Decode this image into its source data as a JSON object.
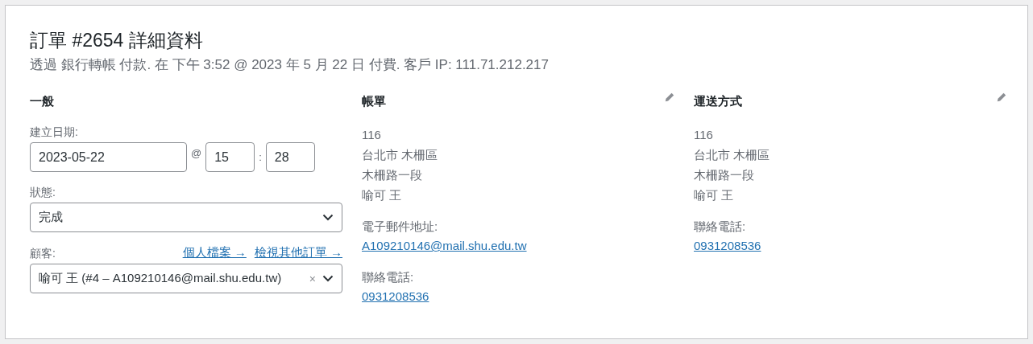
{
  "title": "訂單 #2654 詳細資料",
  "subtitle": "透過 銀行轉帳 付款. 在 下午 3:52 @ 2023 年 5 月 22 日 付費. 客戶 IP: 111.71.212.217",
  "general": {
    "heading": "一般",
    "date_label": "建立日期:",
    "date": "2023-05-22",
    "at": "@",
    "hour": "15",
    "colon": ":",
    "minute": "28",
    "status_label": "狀態:",
    "status": "完成",
    "customer_label": "顧客:",
    "links": [
      "個人檔案 →",
      "檢視其他訂單 →"
    ],
    "customer": "喻可 王 (#4 – A109210146@mail.shu.edu.tw)",
    "clear": "×"
  },
  "columns": [
    {
      "heading": "帳單",
      "address_lines": [
        "116",
        "台北市 木柵區",
        "木柵路一段",
        "喻可 王"
      ],
      "contacts": [
        {
          "label": "電子郵件地址:",
          "value": "A109210146@mail.shu.edu.tw"
        },
        {
          "label": "聯絡電話:",
          "value": "0931208536"
        }
      ]
    },
    {
      "heading": "運送方式",
      "address_lines": [
        "116",
        "台北市 木柵區",
        "木柵路一段",
        "喻可 王"
      ],
      "contacts": [
        {
          "label": "聯絡電話:",
          "value": "0931208536"
        }
      ]
    }
  ]
}
